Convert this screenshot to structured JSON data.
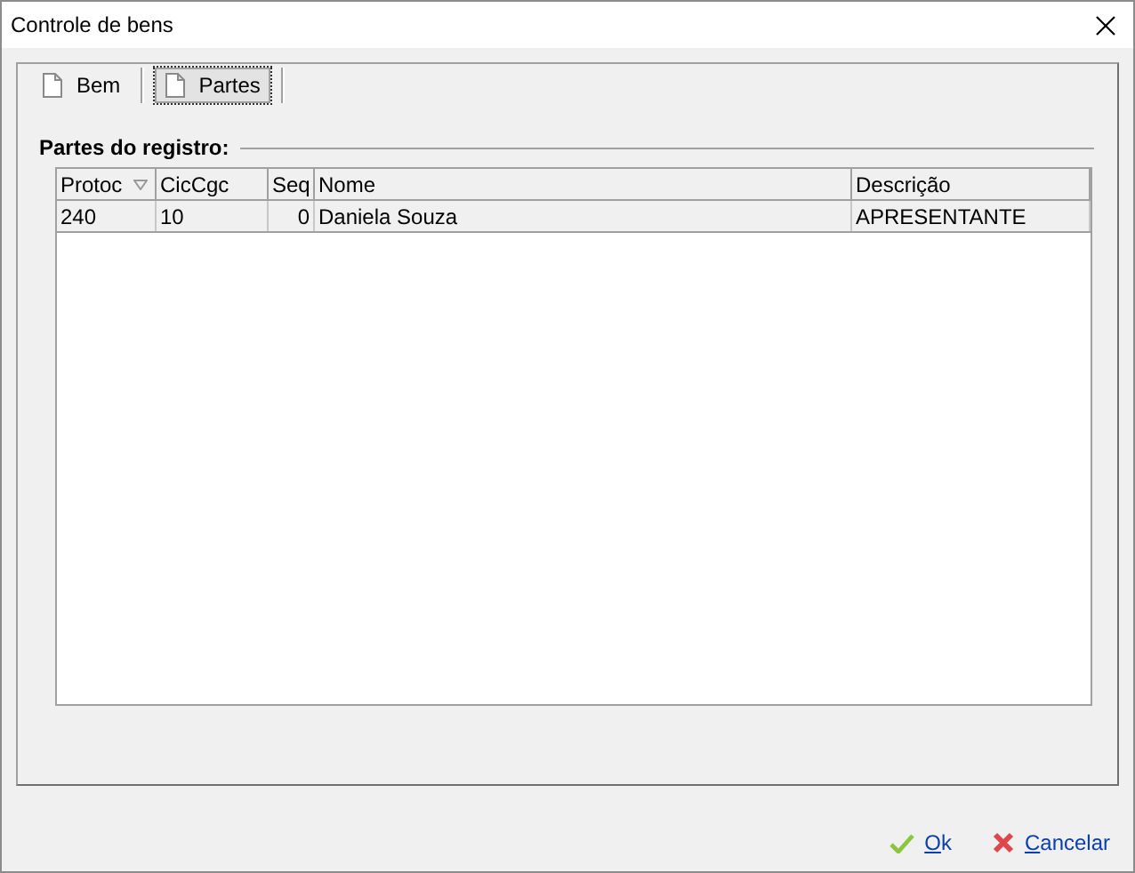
{
  "window": {
    "title": "Controle de bens"
  },
  "tabs": [
    {
      "label": "Bem",
      "selected": false
    },
    {
      "label": "Partes",
      "selected": true
    }
  ],
  "group": {
    "title": "Partes do registro:"
  },
  "table": {
    "columns": [
      {
        "label": "Protoc ",
        "sorted": true
      },
      {
        "label": "CicCgc",
        "sorted": false
      },
      {
        "label": "Seq",
        "sorted": false
      },
      {
        "label": "Nome",
        "sorted": false
      },
      {
        "label": "Descrição",
        "sorted": false
      }
    ],
    "rows": [
      {
        "selected": true,
        "cells": [
          "240",
          "10",
          "0",
          "Daniela Souza",
          "APRESENTANTE"
        ]
      }
    ]
  },
  "buttons": [
    {
      "kind": "ok",
      "label": "Ok"
    },
    {
      "kind": "cancel",
      "label": "Cancelar"
    }
  ]
}
